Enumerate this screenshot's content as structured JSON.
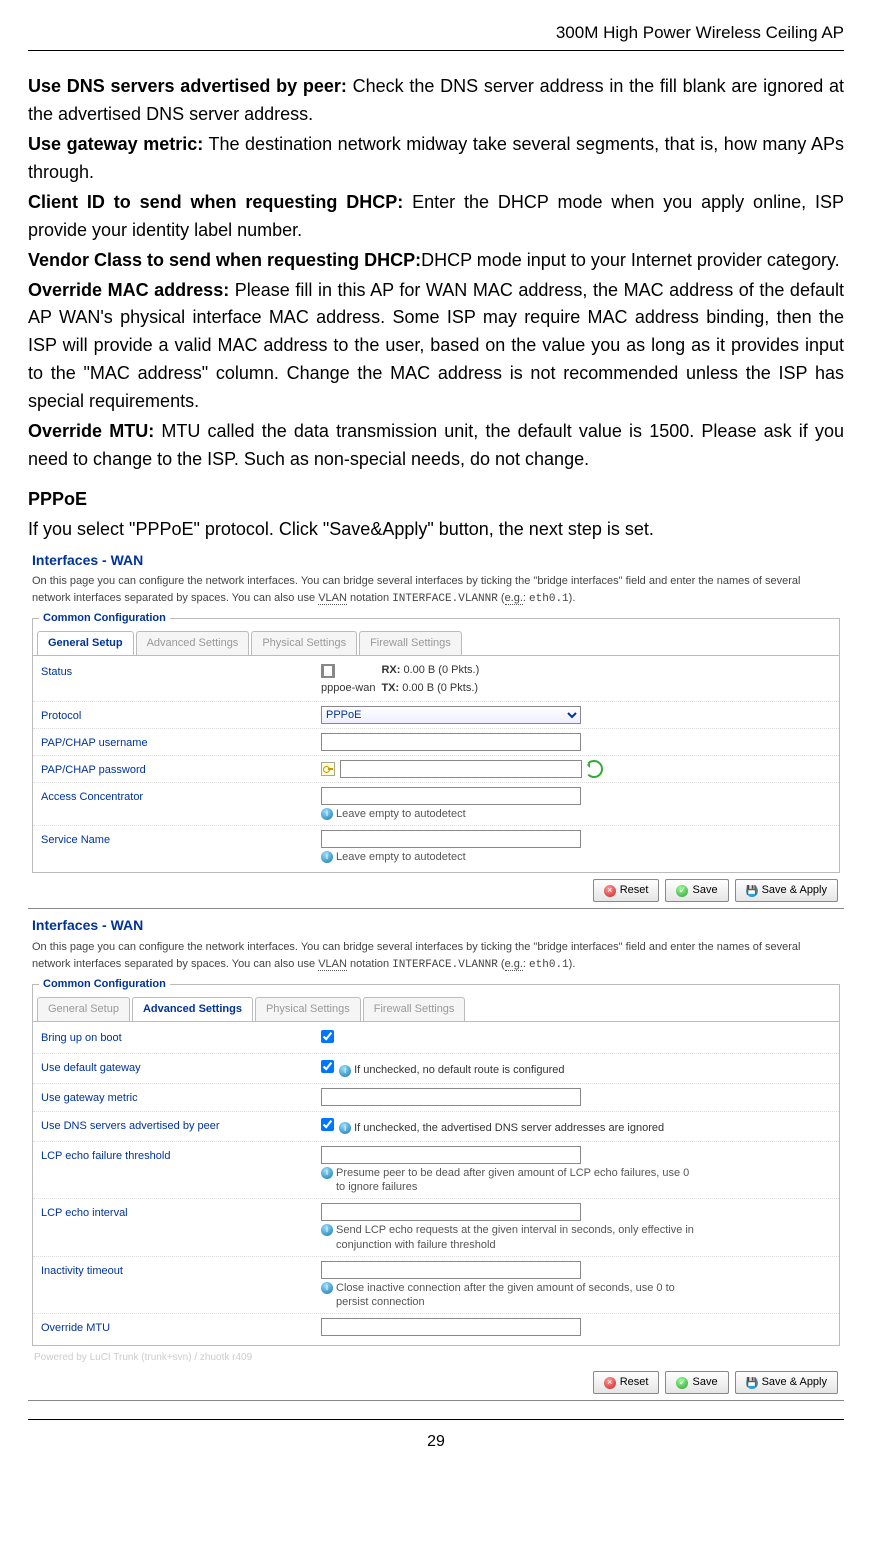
{
  "header": "300M High Power Wireless Ceiling AP",
  "pageNumber": "29",
  "para": {
    "dns_b": "Use DNS servers advertised by peer:",
    "dns_t": " Check the DNS server address in the fill blank are ignored at the advertised DNS server address.",
    "gwm_b": "Use gateway metric:",
    "gwm_t": "   The destination network midway take several segments, that is, how many APs through.",
    "cid_b": "Client ID to send when requesting DHCP:",
    "cid_t": " Enter the DHCP mode when you apply online, ISP provide your identity label number.",
    "vc_b": "Vendor Class to send when requesting DHCP:",
    "vc_t": "DHCP mode input to your Internet provider category.",
    "omac_b": "Override MAC address:",
    "omac_t": " Please fill in this AP for WAN MAC address, the MAC address of the default AP WAN's physical interface MAC address. Some ISP may require MAC address binding, then the ISP will provide a valid MAC address to the user, based on the value you as long as it provides input to the \"MAC address\" column. Change the MAC address is not recommended unless the ISP has special requirements.",
    "omtu_b": "Override MTU:",
    "omtu_t": " MTU called the data transmission unit, the default value is 1500. Please ask if you need to change to the ISP. Such as non-special needs, do not change.",
    "pppoe_h": "PPPoE",
    "pppoe_t": "If you select \"PPPoE\" protocol. Click \"Save&Apply\" button, the next step is set."
  },
  "panel": {
    "title": "Interfaces - WAN",
    "desc1": "On this page you can configure the network interfaces. You can bridge several interfaces by ticking the \"bridge interfaces\" field and enter the names of several network interfaces separated by spaces. You can also use ",
    "vlan": "VLAN",
    "desc2": " notation ",
    "iface": "INTERFACE.VLANNR",
    "desc3": " (",
    "eg": "e.g.",
    "desc4": ": ",
    "egv": "eth0.1",
    "desc5": ").",
    "legend": "Common Configuration",
    "tabs": [
      "General Setup",
      "Advanced Settings",
      "Physical Settings",
      "Firewall Settings"
    ],
    "status_lbl": "Status",
    "status_if": "pppoe-wan",
    "status_rx_l": "RX:",
    "status_rx_v": " 0.00 B (0 Pkts.)",
    "status_tx_l": "TX:",
    "status_tx_v": " 0.00 B (0 Pkts.)",
    "gen": {
      "protocol_lbl": "Protocol",
      "protocol_val": "PPPoE",
      "user_lbl": "PAP/CHAP username",
      "pass_lbl": "PAP/CHAP password",
      "ac_lbl": "Access Concentrator",
      "sn_lbl": "Service Name",
      "autodetect": "Leave empty to autodetect"
    },
    "adv": {
      "boot_lbl": "Bring up on boot",
      "defgw_lbl": "Use default gateway",
      "defgw_hint": "If unchecked, no default route is configured",
      "gwm_lbl": "Use gateway metric",
      "dns_lbl": "Use DNS servers advertised by peer",
      "dns_hint": "If unchecked, the advertised DNS server addresses are ignored",
      "lcpf_lbl": "LCP echo failure threshold",
      "lcpf_hint": "Presume peer to be dead after given amount of LCP echo failures, use 0 to ignore failures",
      "lcpi_lbl": "LCP echo interval",
      "lcpi_hint": "Send LCP echo requests at the given interval in seconds, only effective in conjunction with failure threshold",
      "inact_lbl": "Inactivity timeout",
      "inact_hint": "Close inactive connection after the given amount of seconds, use 0 to persist connection",
      "omtu_lbl": "Override MTU"
    },
    "buttons": {
      "reset": "Reset",
      "save": "Save",
      "saveapply": "Save & Apply"
    },
    "powered": "Powered by LuCI Trunk (trunk+svn) / zhuotk r409"
  }
}
